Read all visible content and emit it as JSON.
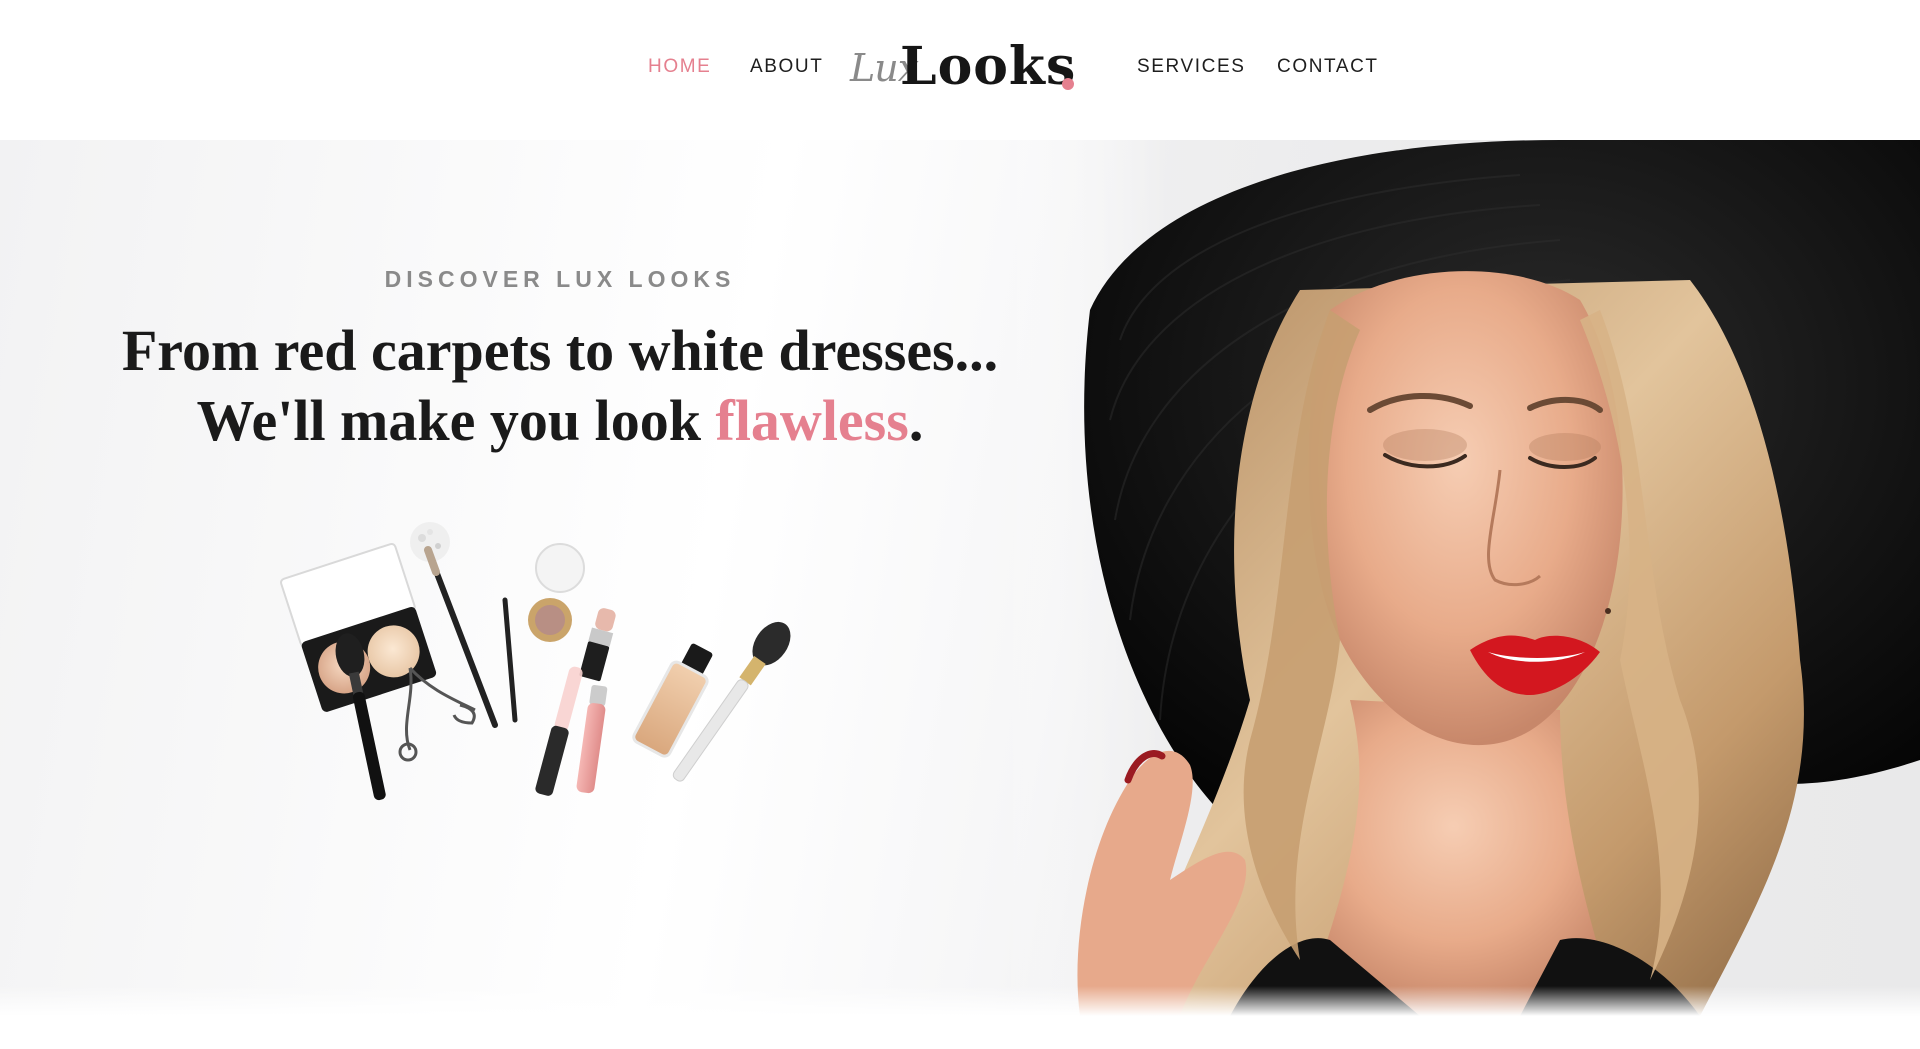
{
  "brand": {
    "logo_script": "Lux",
    "logo_main": "Looks",
    "accent_color": "#e5808f"
  },
  "nav": {
    "items": [
      {
        "label": "HOME",
        "active": true
      },
      {
        "label": "ABOUT",
        "active": false
      },
      {
        "label": "SERVICES",
        "active": false
      },
      {
        "label": "CONTACT",
        "active": false
      }
    ]
  },
  "hero": {
    "kicker": "DISCOVER LUX LOOKS",
    "headline_line1": "From red carpets to white dresses...",
    "headline_line2_prefix": "We'll make you look ",
    "headline_accent": "flawless",
    "headline_suffix": "."
  },
  "icons": {
    "makeup": "makeup-flatlay-image",
    "portrait": "model-portrait-image"
  }
}
